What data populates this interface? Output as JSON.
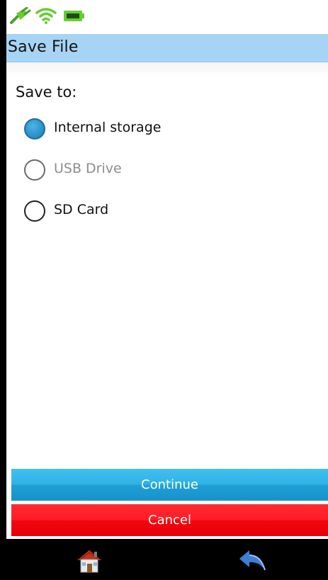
{
  "status_bar": {
    "icons": [
      "plug-icon",
      "wifi-icon",
      "battery-icon"
    ],
    "colors": {
      "icon_green": "#66cc33",
      "battery_dark": "#1d4d14"
    }
  },
  "header": {
    "title": "Save File",
    "background": "#a7d4f5"
  },
  "main": {
    "prompt": "Save to:",
    "options": [
      {
        "label": "Internal storage",
        "selected": true,
        "enabled": true
      },
      {
        "label": "USB Drive",
        "selected": false,
        "enabled": false
      },
      {
        "label": "SD Card",
        "selected": false,
        "enabled": true
      }
    ]
  },
  "buttons": {
    "continue_label": "Continue",
    "cancel_label": "Cancel",
    "continue_color": "#31b2e6",
    "cancel_color": "#ff1c24"
  },
  "nav": {
    "icons": [
      "home-icon",
      "back-icon"
    ]
  }
}
